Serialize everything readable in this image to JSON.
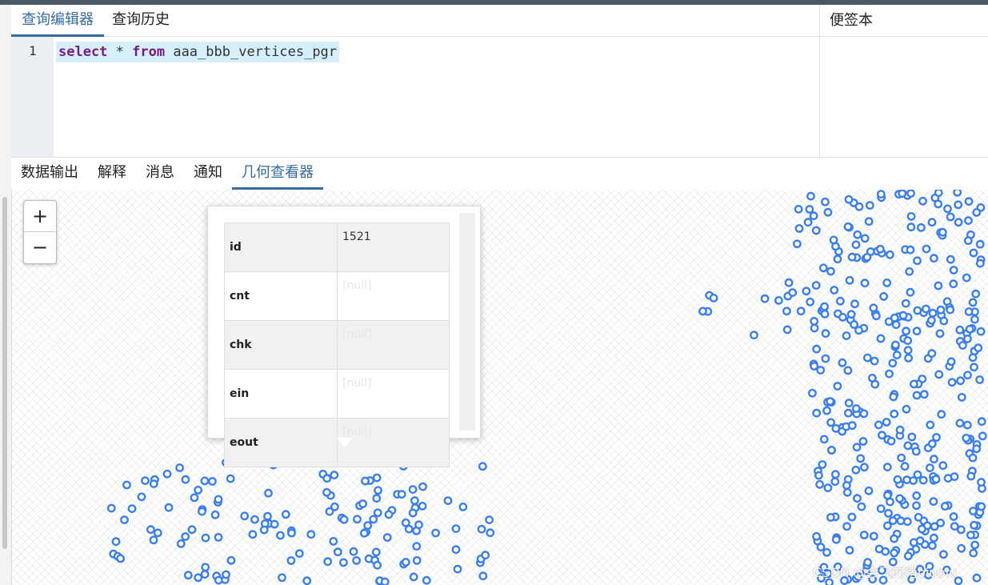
{
  "editor_tabs": [
    "查询编辑器",
    "查询历史"
  ],
  "scratch_pad": {
    "title": "便签本"
  },
  "editor": {
    "line_number": "1",
    "sql": {
      "kw1": "select",
      "star": " * ",
      "kw2": "from",
      "table": " aaa_bbb_vertices_pgr"
    }
  },
  "result_tabs": [
    "数据输出",
    "解释",
    "消息",
    "通知",
    "几何查看器"
  ],
  "active_result_tab": "几何查看器",
  "map": {
    "zoom_in": "+",
    "zoom_out": "−",
    "point_color": "#3a7ff0",
    "popup": {
      "rows": [
        {
          "key": "id",
          "value": "1521"
        },
        {
          "key": "cnt",
          "value": "[null]"
        },
        {
          "key": "chk",
          "value": "[null]"
        },
        {
          "key": "ein",
          "value": "[null]"
        },
        {
          "key": "eout",
          "value": "[null]"
        }
      ]
    }
  },
  "watermark": "CSDN @会飞的猪biubiu"
}
